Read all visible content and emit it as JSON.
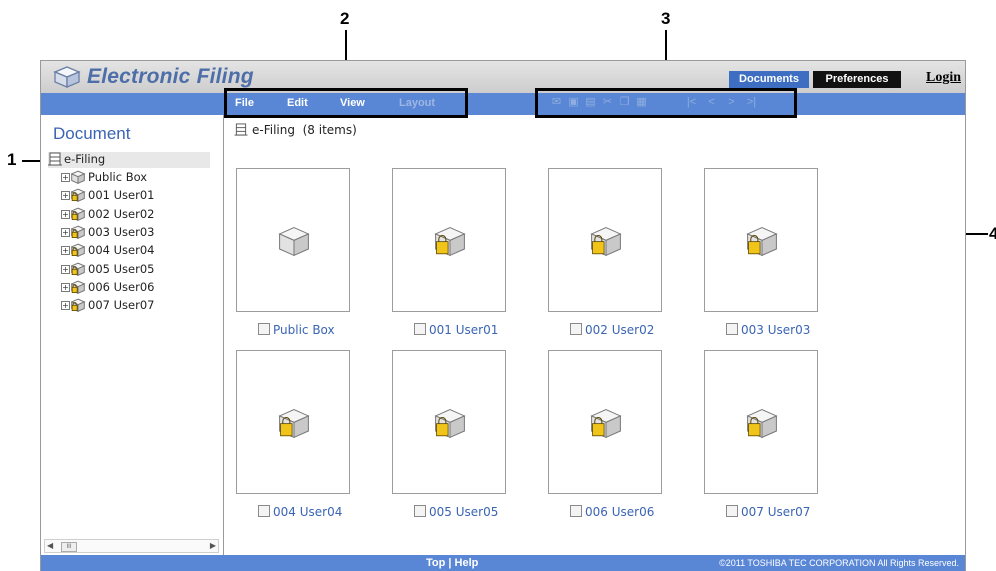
{
  "callouts": [
    "1",
    "2",
    "3",
    "4"
  ],
  "app": {
    "title": "Electronic Filing",
    "tabs": {
      "documents": "Documents",
      "preferences": "Preferences"
    },
    "login": "Login"
  },
  "menu": {
    "file": "File",
    "edit": "Edit",
    "view": "View",
    "layout": "Layout"
  },
  "toolbar": {
    "icons": [
      "new-box-icon",
      "save-icon",
      "print-icon",
      "cut-icon",
      "copy-icon",
      "paste-icon",
      "first-page-icon",
      "previous-page-icon",
      "next-page-icon",
      "last-page-icon"
    ]
  },
  "sidebar": {
    "heading": "Document",
    "root": "e-Filing",
    "items": [
      {
        "label": "Public Box",
        "locked": false
      },
      {
        "label": "001 User01",
        "locked": true
      },
      {
        "label": "002 User02",
        "locked": true
      },
      {
        "label": "003 User03",
        "locked": true
      },
      {
        "label": "004 User04",
        "locked": true
      },
      {
        "label": "005 User05",
        "locked": true
      },
      {
        "label": "006 User06",
        "locked": true
      },
      {
        "label": "007 User07",
        "locked": true
      }
    ],
    "scroll_thumb": "III"
  },
  "main": {
    "location": "e-Filing",
    "item_count": "(8 items)",
    "boxes": [
      {
        "label": "Public Box",
        "locked": false
      },
      {
        "label": "001 User01",
        "locked": true
      },
      {
        "label": "002 User02",
        "locked": true
      },
      {
        "label": "003 User03",
        "locked": true
      },
      {
        "label": "004 User04",
        "locked": true
      },
      {
        "label": "005 User05",
        "locked": true
      },
      {
        "label": "006 User06",
        "locked": true
      },
      {
        "label": "007 User07",
        "locked": true
      }
    ]
  },
  "footer": {
    "top": "Top",
    "separator": " | ",
    "help": "Help",
    "copyright": "©2011 TOSHIBA TEC CORPORATION All Rights Reserved."
  },
  "colors": {
    "accent_blue": "#5987d5",
    "title_blue": "#4d6ea8",
    "link_blue": "#3a64b4"
  }
}
